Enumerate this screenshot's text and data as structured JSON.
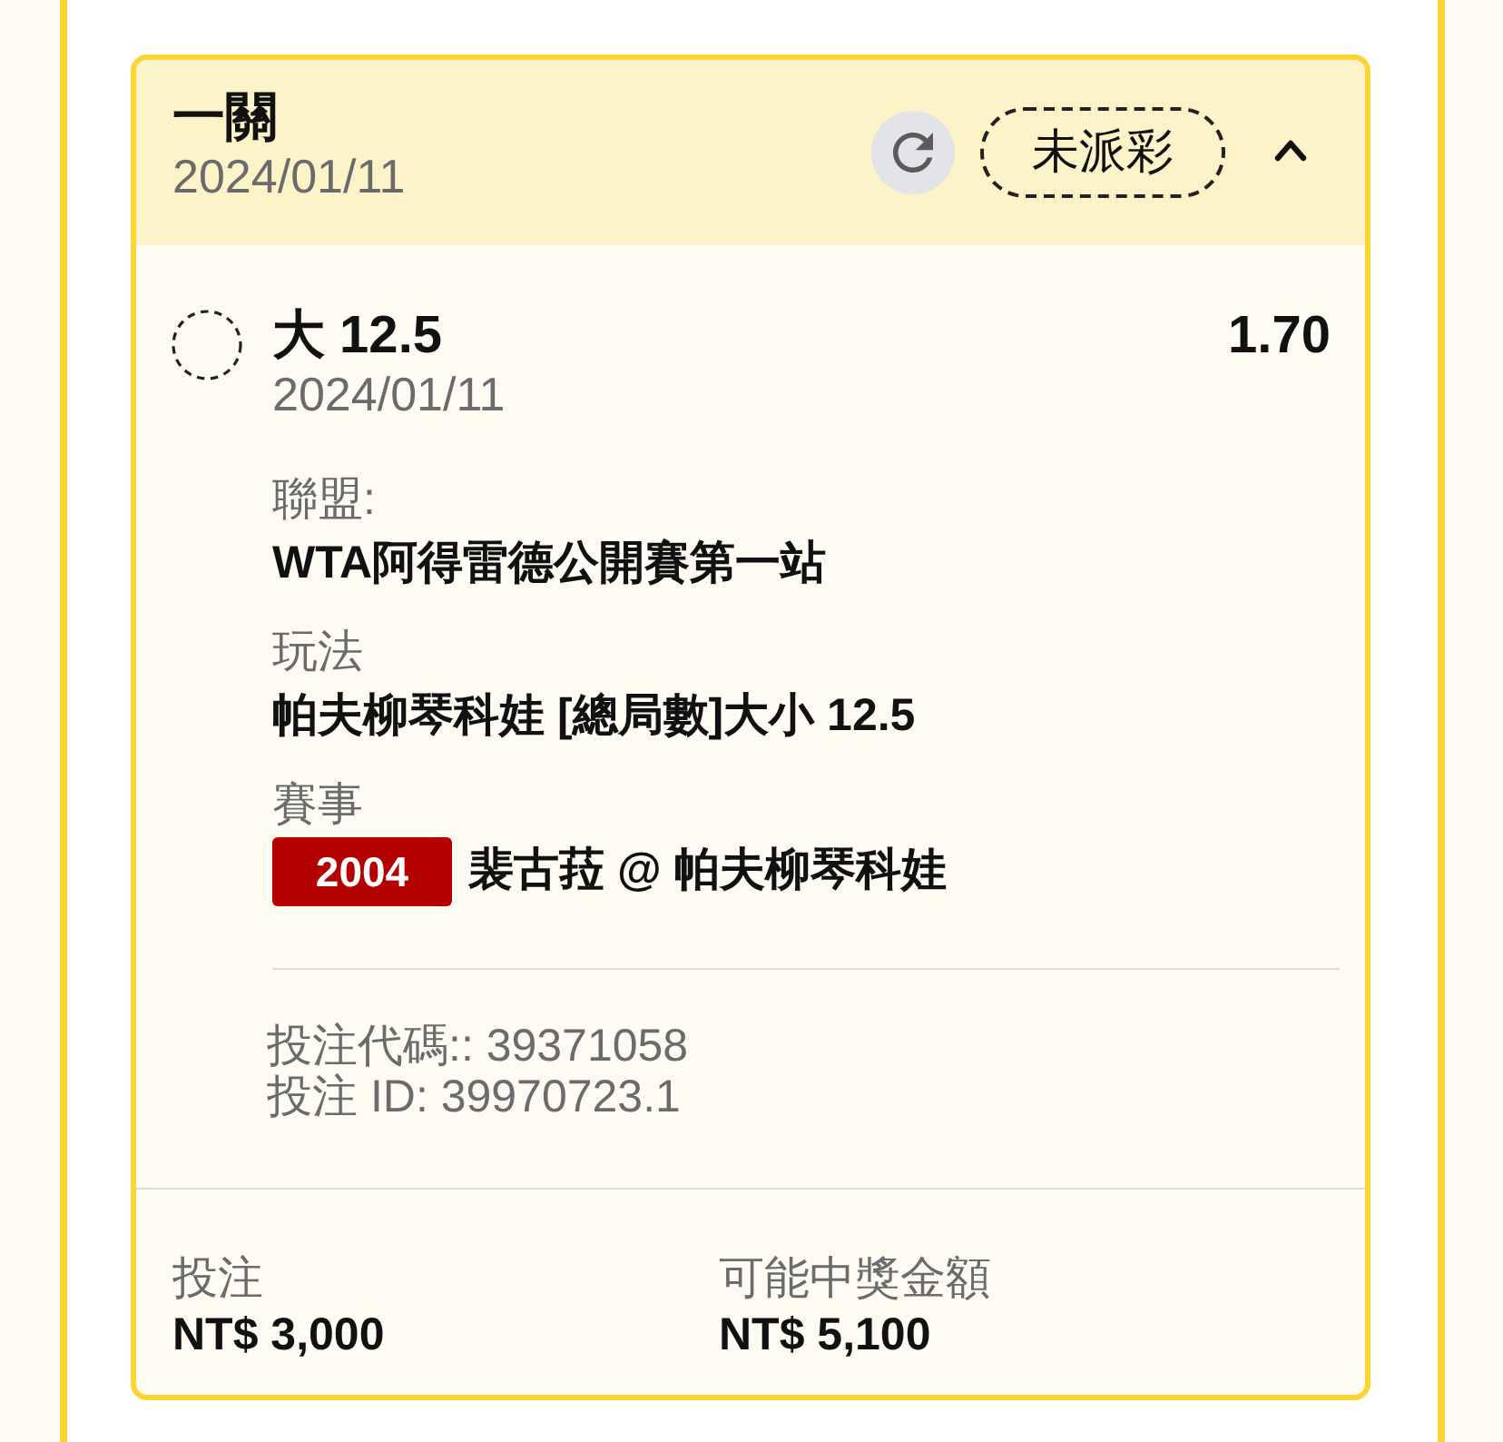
{
  "bet_card": {
    "title": "一關",
    "date": "2024/01/11",
    "status": "未派彩",
    "expanded": true,
    "selection": {
      "pick": "大 12.5",
      "date": "2024/01/11",
      "odds": "1.70"
    },
    "details": [
      {
        "kind": "text",
        "label": "聯盟:",
        "value": "WTA阿得雷德公開賽第一站"
      },
      {
        "kind": "text",
        "label": "玩法",
        "value": "帕夫柳琴科娃 [總局數]大小 12.5"
      },
      {
        "kind": "match",
        "label": "賽事",
        "badge": "2004",
        "value": "裴古菈 @ 帕夫柳琴科娃"
      }
    ],
    "references": [
      "投注代碼:: 39371058",
      "投注 ID: 39970723.1"
    ],
    "totals": [
      {
        "label": "投注",
        "value": "NT$ 3,000"
      },
      {
        "label": "可能中獎金額",
        "value": "NT$ 5,100"
      }
    ]
  }
}
